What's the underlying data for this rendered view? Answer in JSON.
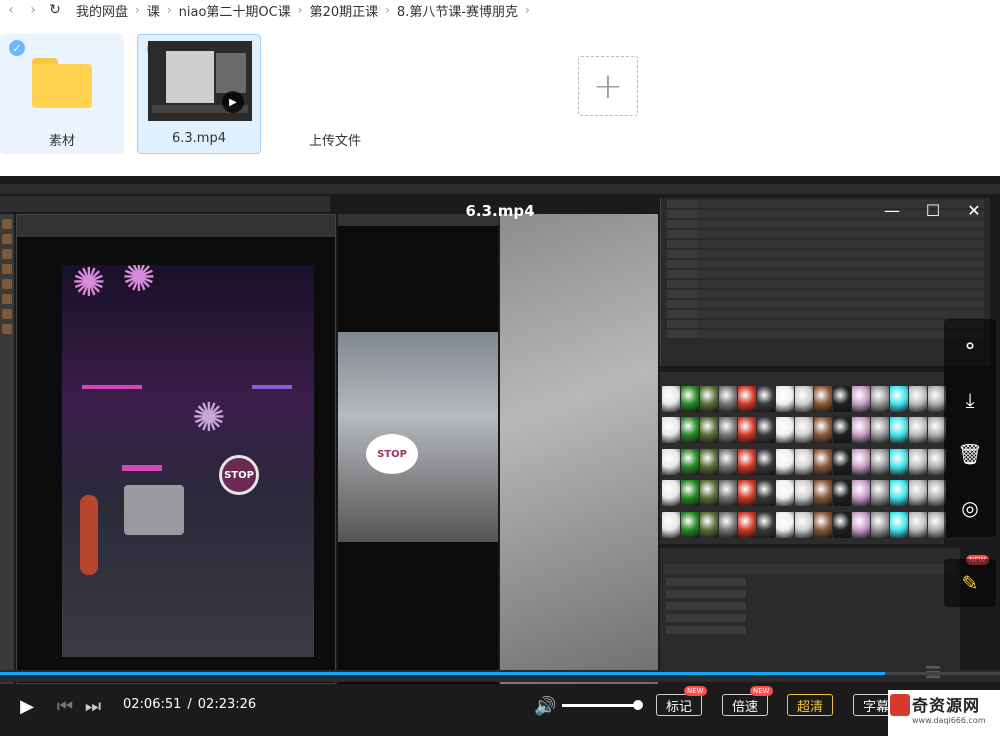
{
  "breadcrumb": {
    "items": [
      "我的网盘",
      "课",
      "niao第二十期OC课",
      "第20期正课",
      "8.第八节课-赛博朋克"
    ]
  },
  "files": [
    {
      "name": "素材",
      "type": "folder"
    },
    {
      "name": "6.3.mp4",
      "type": "video"
    },
    {
      "name": "上传文件",
      "type": "upload"
    }
  ],
  "player": {
    "title": "6.3.mp4",
    "current_time": "02:06:51",
    "total_time": "02:23:26",
    "time_separator": "/",
    "progress": 0.885,
    "volume": 1.0,
    "buttons": {
      "mark": "标记",
      "speed": "倍速",
      "quality": "超清",
      "subtitle": "字幕"
    },
    "new_tag": "NEW"
  },
  "video_frame": {
    "stop_sign": "STOP"
  },
  "watermark": {
    "name": "奇资源网",
    "url": "www.daqi666.com"
  },
  "colors": {
    "accent": "#0fa6ff",
    "folder": "#ffd34e",
    "selection": "#eaf4ff",
    "quality_active": "#f3c446",
    "new_badge": "#ff4a4a"
  }
}
